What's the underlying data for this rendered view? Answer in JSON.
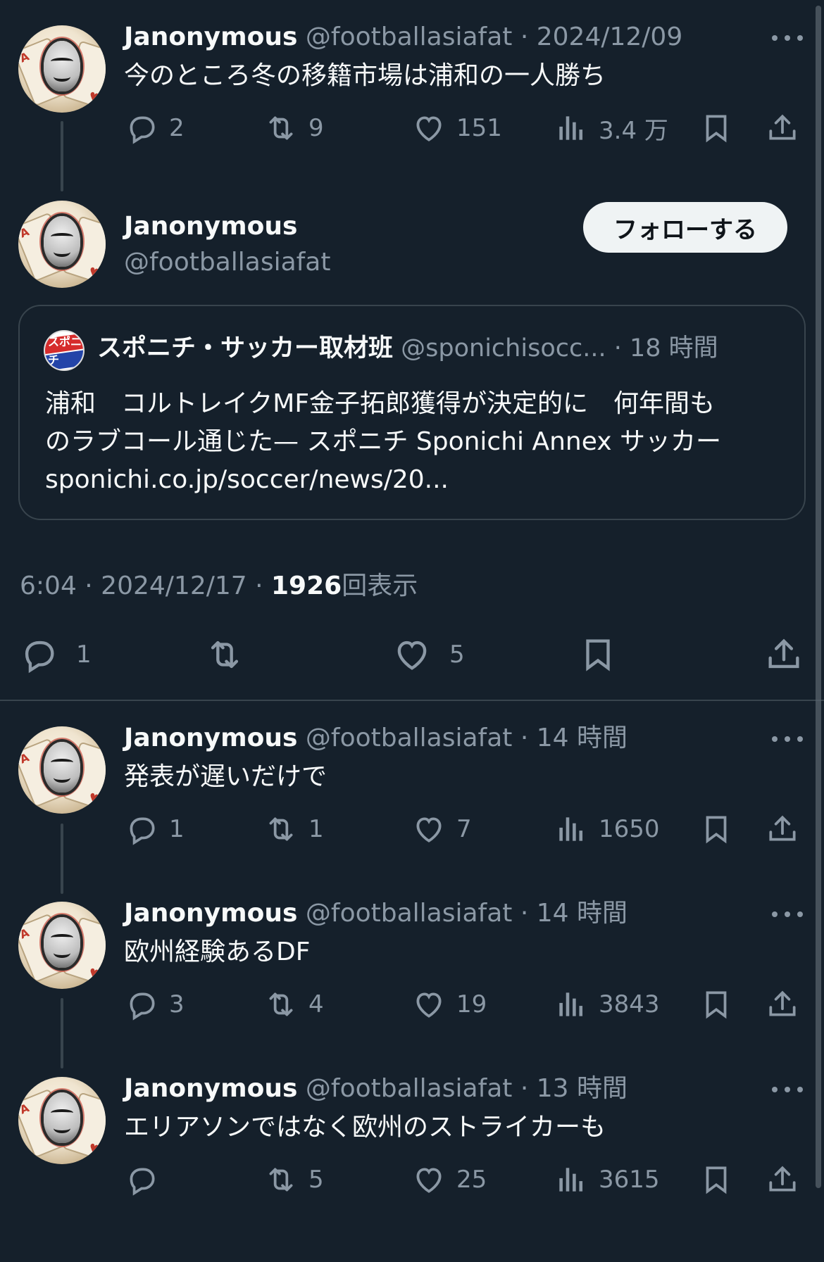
{
  "tweets_above": [
    {
      "name": "Janonymous",
      "handle": "@footballasiafat",
      "sep": "·",
      "time": "2024/12/09",
      "text": "今のところ冬の移籍市場は浦和の一人勝ち",
      "replies": "2",
      "retweets": "9",
      "likes": "151",
      "views": "3.4 万"
    }
  ],
  "main_tweet": {
    "name": "Janonymous",
    "handle": "@footballasiafat",
    "follow_label": "フォローする",
    "quote": {
      "avatar_text": "スポニチ",
      "name": "スポニチ・サッカー取材班",
      "handle": "@sponichisocc...",
      "sep": "·",
      "time": "18 時間",
      "line1": "浦和　コルトレイクMF金子拓郎獲得が決定的に　何年間も",
      "line2": "のラブコール通じた— スポニチ Sponichi Annex サッカー",
      "line3": "sponichi.co.jp/soccer/news/20..."
    },
    "meta_time": "6:04 · 2024/12/17 · ",
    "meta_views": "1926",
    "meta_views_label": "回表示",
    "replies": "1",
    "retweets": "",
    "likes": "5"
  },
  "replies": [
    {
      "name": "Janonymous",
      "handle": "@footballasiafat",
      "sep": "·",
      "time": "14 時間",
      "text": "発表が遅いだけで",
      "replies": "1",
      "retweets": "1",
      "likes": "7",
      "views": "1650"
    },
    {
      "name": "Janonymous",
      "handle": "@footballasiafat",
      "sep": "·",
      "time": "14 時間",
      "text": "欧州経験あるDF",
      "replies": "3",
      "retweets": "4",
      "likes": "19",
      "views": "3843"
    },
    {
      "name": "Janonymous",
      "handle": "@footballasiafat",
      "sep": "·",
      "time": "13 時間",
      "text": "エリアソンではなく欧州のストライカーも",
      "replies": "",
      "retweets": "5",
      "likes": "25",
      "views": "3615"
    }
  ],
  "icons": {
    "reply": "reply-icon",
    "retweet": "retweet-icon",
    "like": "heart-icon",
    "views": "views-icon",
    "bookmark": "bookmark-icon",
    "share": "share-icon",
    "more": "more-icon"
  },
  "colors": {
    "background": "#15202b",
    "text": "#f7f9f9",
    "secondary": "#8b98a5",
    "border": "#38444d",
    "follow_bg": "#eff3f4"
  }
}
